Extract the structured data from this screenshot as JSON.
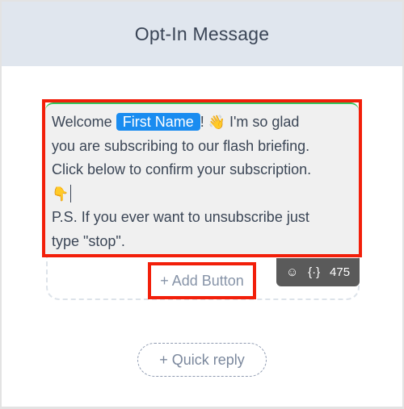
{
  "header": {
    "title": "Opt-In Message"
  },
  "message": {
    "line1_before_chip": "Welcome",
    "chip_label": "First Name",
    "line1_after_chip": "!",
    "wave_emoji": "👋",
    "line1_tail": "I'm so glad",
    "line2": "you are subscribing to our flash briefing.",
    "line3": "Click below to confirm your subscription.",
    "pointing_emoji": "👇",
    "line5": "P.S. If you ever want to unsubscribe just",
    "line6": "type \"stop\"."
  },
  "toolbar": {
    "emoji_icon": "☺",
    "variables_icon": "{·}",
    "char_count": "475"
  },
  "add_button": {
    "label": "+ Add Button"
  },
  "quick_reply": {
    "label": "+ Quick reply"
  },
  "colors": {
    "header_bg": "#e0e6ee",
    "chip_bg": "#1a8cf0",
    "highlight_red": "#f21f0a",
    "bubble_bg": "#f0f0f0",
    "toolbar_bg": "#5a5a5a"
  }
}
